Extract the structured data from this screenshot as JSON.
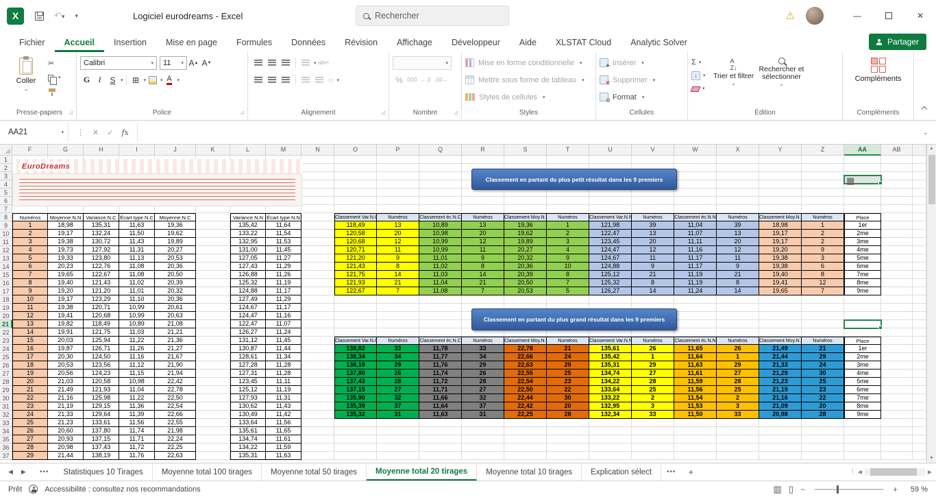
{
  "titlebar": {
    "app_title": "Logiciel eurodreams -  Excel",
    "search_placeholder": "Rechercher"
  },
  "ribbon": {
    "tabs": [
      "Fichier",
      "Accueil",
      "Insertion",
      "Mise en page",
      "Formules",
      "Données",
      "Révision",
      "Affichage",
      "Développeur",
      "Aide",
      "XLSTAT Cloud",
      "Analytic Solver"
    ],
    "active_tab": "Accueil",
    "share_label": "Partager",
    "paste_label": "Coller",
    "font_name": "Calibri",
    "font_size": "11",
    "bold_label": "G",
    "italic_label": "I",
    "underline_label": "S",
    "percent_label": "%",
    "thousands_label": "000",
    "decimal_labels": [
      "←,0",
      ",00→"
    ],
    "styles_items": [
      "Mise en forme conditionnelle",
      "Mettre sous forme de tableau",
      "Styles de cellules"
    ],
    "cells_items": [
      "Insérer",
      "Supprimer",
      "Format"
    ],
    "edition_items": [
      "Trier et filtrer",
      "Rechercher et sélectionner"
    ],
    "complements_label": "Compléments",
    "group_labels": [
      "Presse-papiers",
      "Police",
      "Alignement",
      "Nombre",
      "Styles",
      "Cellules",
      "Édition",
      "Compléments"
    ],
    "accent_green": "#0f7b41"
  },
  "formula_bar": {
    "name_box": "AA21",
    "fx_label": "fx",
    "formula_value": ""
  },
  "sheet": {
    "columns": [
      "F",
      "G",
      "H",
      "I",
      "J",
      "K",
      "L",
      "M",
      "N",
      "O",
      "P",
      "Q",
      "R",
      "S",
      "T",
      "U",
      "V",
      "W",
      "X",
      "Y",
      "Z",
      "AA",
      "AB"
    ],
    "row_count": 37,
    "selected_cell": "AA21",
    "selected_column": "AA",
    "selected_row": 21,
    "ticket_label": "EuroDreams",
    "banners": [
      "Classement en partant du plus petit résultat dans les 9 premiers",
      "Classement en partant du plus grand résultat dans les 9 premiers"
    ],
    "left_table": {
      "headers": [
        "Numéros",
        "Moyenne.N.N",
        "Variance.N.C",
        "Écart type.N.C",
        "Moyenne.N.C"
      ],
      "number_column_color": "#f8cbad",
      "rows": [
        [
          "1",
          "18,98",
          "135,31",
          "11,63",
          "19,36"
        ],
        [
          "2",
          "19,17",
          "132,24",
          "11,50",
          "19,62"
        ],
        [
          "3",
          "19,38",
          "130,72",
          "11,43",
          "19,89"
        ],
        [
          "4",
          "19,73",
          "127,92",
          "11,31",
          "20,27"
        ],
        [
          "5",
          "19,33",
          "123,80",
          "11,13",
          "20,53"
        ],
        [
          "6",
          "20,23",
          "122,76",
          "11,08",
          "20,36"
        ],
        [
          "7",
          "19,65",
          "122,67",
          "11,08",
          "20,50"
        ],
        [
          "8",
          "19,40",
          "121,43",
          "11,02",
          "20,39"
        ],
        [
          "9",
          "19,20",
          "121,20",
          "11,01",
          "20,32"
        ],
        [
          "10",
          "19,17",
          "123,29",
          "11,10",
          "20,36"
        ],
        [
          "11",
          "19,38",
          "120,71",
          "10,99",
          "20,61"
        ],
        [
          "12",
          "19,41",
          "120,68",
          "10,99",
          "20,63"
        ],
        [
          "13",
          "19,82",
          "118,49",
          "10,89",
          "21,08"
        ],
        [
          "14",
          "19,91",
          "121,75",
          "11,03",
          "21,21"
        ],
        [
          "15",
          "20,03",
          "125,94",
          "11,22",
          "21,36"
        ],
        [
          "16",
          "19,87",
          "126,71",
          "11,26",
          "21,27"
        ],
        [
          "17",
          "20,30",
          "124,50",
          "11,16",
          "21,67"
        ],
        [
          "18",
          "20,53",
          "123,56",
          "11,12",
          "21,90"
        ],
        [
          "19",
          "20,56",
          "124,23",
          "11,15",
          "21,94"
        ],
        [
          "20",
          "21,03",
          "120,58",
          "10,98",
          "22,42"
        ],
        [
          "21",
          "21,49",
          "121,93",
          "11,04",
          "22,78"
        ],
        [
          "22",
          "21,16",
          "125,98",
          "11,22",
          "22,50"
        ],
        [
          "23",
          "21,19",
          "129,15",
          "11,36",
          "22,54"
        ],
        [
          "24",
          "21,33",
          "129,64",
          "11,39",
          "22,66"
        ],
        [
          "25",
          "21,23",
          "133,61",
          "11,56",
          "22,55"
        ],
        [
          "26",
          "20,60",
          "137,80",
          "11,74",
          "21,98"
        ],
        [
          "27",
          "20,93",
          "137,15",
          "11,71",
          "22,24"
        ],
        [
          "28",
          "20,98",
          "137,43",
          "11,72",
          "22,25"
        ],
        [
          "29",
          "21,44",
          "138,19",
          "11,76",
          "22,63"
        ]
      ]
    },
    "middle_table": {
      "headers": [
        "Variance.N.N",
        "Écart type.N.N"
      ],
      "rows": [
        [
          "135,42",
          "11,64"
        ],
        [
          "133,22",
          "11,54"
        ],
        [
          "132,95",
          "11,53"
        ],
        [
          "131,00",
          "11,45"
        ],
        [
          "127,05",
          "11,27"
        ],
        [
          "127,43",
          "11,29"
        ],
        [
          "126,88",
          "11,26"
        ],
        [
          "125,32",
          "11,19"
        ],
        [
          "124,88",
          "11,17"
        ],
        [
          "127,49",
          "11,29"
        ],
        [
          "124,67",
          "11,17"
        ],
        [
          "124,47",
          "11,16"
        ],
        [
          "122,47",
          "11,07"
        ],
        [
          "126,27",
          "11,24"
        ],
        [
          "131,12",
          "11,45"
        ],
        [
          "130,87",
          "11,44"
        ],
        [
          "128,61",
          "11,34"
        ],
        [
          "127,28",
          "11,28"
        ],
        [
          "127,31",
          "11,28"
        ],
        [
          "123,45",
          "11,11"
        ],
        [
          "125,12",
          "11,19"
        ],
        [
          "127,93",
          "11,31"
        ],
        [
          "130,62",
          "11,43"
        ],
        [
          "130,49",
          "11,42"
        ],
        [
          "133,64",
          "11,56"
        ],
        [
          "135,61",
          "11,65"
        ],
        [
          "134,74",
          "11,61"
        ],
        [
          "134,22",
          "11,59"
        ],
        [
          "135,31",
          "11,63"
        ]
      ]
    },
    "rank_tables": [
      {
        "headers": [
          "Classement Var.N.C",
          "Numéros",
          "Classement éc.N.C",
          "Numéros",
          "Classement Moy.N.C",
          "Numéros",
          "Classement Var.N.N",
          "Numéros",
          "Classement éc.N.N",
          "Numéros",
          "Classement Moy.N.N",
          "Numéros"
        ],
        "place_header": "Place",
        "places": [
          "1er",
          "2me",
          "3me",
          "4me",
          "5me",
          "6me",
          "7me",
          "8me",
          "9me"
        ],
        "header_color": "#dce6f2",
        "pair_colors": [
          "#ffff00",
          "#92d050",
          "#92d050",
          "#b4c6e7",
          "#b4c6e7",
          "#f8cbad"
        ],
        "bold_values": false,
        "rows": [
          [
            "118,49",
            "13",
            "10,89",
            "13",
            "19,36",
            "1",
            "121,98",
            "39",
            "11,04",
            "39",
            "18,98",
            "1"
          ],
          [
            "120,58",
            "20",
            "10,98",
            "20",
            "19,62",
            "2",
            "122,47",
            "13",
            "11,07",
            "13",
            "19,17",
            "2"
          ],
          [
            "120,68",
            "12",
            "10,99",
            "12",
            "19,89",
            "3",
            "123,45",
            "20",
            "11,11",
            "20",
            "19,17",
            "2"
          ],
          [
            "120,71",
            "11",
            "10,99",
            "11",
            "20,27",
            "4",
            "124,47",
            "12",
            "11,16",
            "12",
            "19,20",
            "9"
          ],
          [
            "121,20",
            "9",
            "11,01",
            "9",
            "20,32",
            "9",
            "124,67",
            "11",
            "11,17",
            "11",
            "19,38",
            "3"
          ],
          [
            "121,43",
            "8",
            "11,02",
            "8",
            "20,36",
            "10",
            "124,88",
            "9",
            "11,17",
            "9",
            "19,38",
            "6"
          ],
          [
            "121,75",
            "14",
            "11,03",
            "14",
            "20,39",
            "8",
            "125,12",
            "21",
            "11,19",
            "21",
            "19,40",
            "8"
          ],
          [
            "121,93",
            "21",
            "11,04",
            "21",
            "20,50",
            "7",
            "125,32",
            "8",
            "11,19",
            "8",
            "19,41",
            "12"
          ],
          [
            "122,67",
            "7",
            "11,08",
            "7",
            "20,53",
            "5",
            "126,27",
            "14",
            "11,24",
            "14",
            "19,65",
            "7"
          ]
        ]
      },
      {
        "headers": [
          "Classement Var.N.C",
          "Numéros",
          "Classement éc.N.C",
          "Numéros",
          "Classement Moy.N.C",
          "Numéros",
          "Classement Var.N.N",
          "Numéros",
          "Classement éc.N.N",
          "Numéros",
          "Classement Moy.N.N",
          "Numéros"
        ],
        "place_header": "Place",
        "places": [
          "1er",
          "2me",
          "3me",
          "4me",
          "5me",
          "6me",
          "7me",
          "8me",
          "9me"
        ],
        "header_color": "#dce6f2",
        "pair_colors": [
          "#00b050",
          "#808080",
          "#e26b0a",
          "#ffff00",
          "#ffc000",
          "#2e9bd5"
        ],
        "bold_values": true,
        "rows": [
          [
            "138,82",
            "33",
            "11,78",
            "33",
            "22,78",
            "21",
            "135,61",
            "26",
            "11,65",
            "26",
            "21,49",
            "21"
          ],
          [
            "138,34",
            "34",
            "11,77",
            "34",
            "22,66",
            "24",
            "135,42",
            "1",
            "11,64",
            "1",
            "21,44",
            "29"
          ],
          [
            "138,19",
            "29",
            "11,76",
            "29",
            "22,63",
            "29",
            "135,31",
            "29",
            "11,63",
            "29",
            "21,33",
            "24"
          ],
          [
            "137,80",
            "26",
            "11,74",
            "26",
            "22,55",
            "25",
            "134,74",
            "27",
            "11,61",
            "27",
            "21,29",
            "30"
          ],
          [
            "137,43",
            "28",
            "11,72",
            "28",
            "22,54",
            "23",
            "134,22",
            "28",
            "11,59",
            "28",
            "21,23",
            "25"
          ],
          [
            "137,15",
            "27",
            "11,71",
            "27",
            "22,50",
            "22",
            "133,64",
            "25",
            "11,56",
            "25",
            "21,19",
            "23"
          ],
          [
            "135,90",
            "32",
            "11,66",
            "32",
            "22,44",
            "30",
            "133,22",
            "2",
            "11,54",
            "2",
            "21,16",
            "22"
          ],
          [
            "135,39",
            "37",
            "11,64",
            "37",
            "22,42",
            "20",
            "132,95",
            "3",
            "11,53",
            "3",
            "21,09",
            "20"
          ],
          [
            "135,32",
            "31",
            "11,63",
            "31",
            "22,25",
            "28",
            "132,34",
            "33",
            "11,50",
            "33",
            "20,98",
            "28"
          ]
        ]
      }
    ]
  },
  "sheet_tabs": {
    "items": [
      "Statistiques 10 Tirages",
      "Moyenne total 100 tirages",
      "Moyenne total 50 tirages",
      "Moyenne total 20 tirages",
      "Moyenne total 10 tirages",
      "Explication sélect"
    ],
    "active": "Moyenne total 20 tirages",
    "more_indicator": "•••"
  },
  "status_bar": {
    "mode": "Prêt",
    "accessibility_text": "Accessibilité : consultez nos recommandations",
    "zoom_label": "59 %"
  }
}
